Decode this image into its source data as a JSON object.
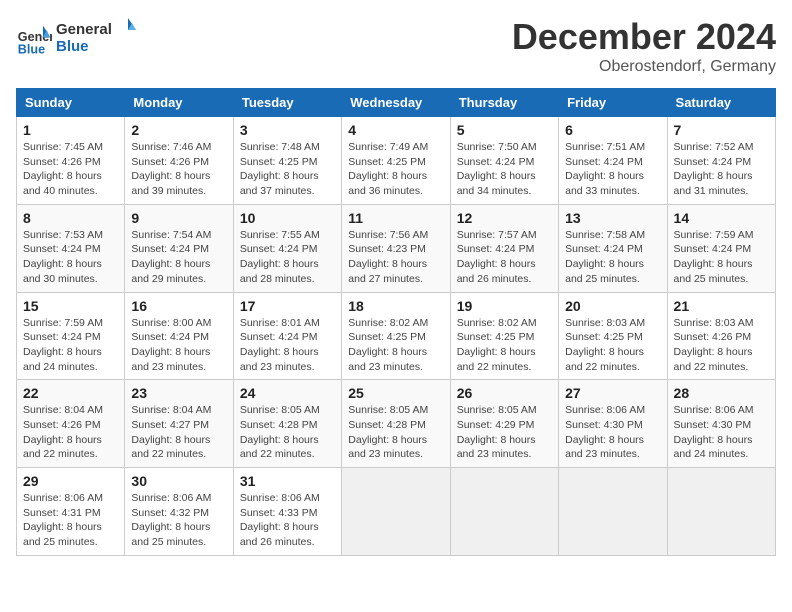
{
  "logo": {
    "line1": "General",
    "line2": "Blue"
  },
  "title": "December 2024",
  "location": "Oberostendorf, Germany",
  "days_of_week": [
    "Sunday",
    "Monday",
    "Tuesday",
    "Wednesday",
    "Thursday",
    "Friday",
    "Saturday"
  ],
  "weeks": [
    [
      {
        "day": "1",
        "sunrise": "7:45 AM",
        "sunset": "4:26 PM",
        "daylight": "8 hours and 40 minutes."
      },
      {
        "day": "2",
        "sunrise": "7:46 AM",
        "sunset": "4:26 PM",
        "daylight": "8 hours and 39 minutes."
      },
      {
        "day": "3",
        "sunrise": "7:48 AM",
        "sunset": "4:25 PM",
        "daylight": "8 hours and 37 minutes."
      },
      {
        "day": "4",
        "sunrise": "7:49 AM",
        "sunset": "4:25 PM",
        "daylight": "8 hours and 36 minutes."
      },
      {
        "day": "5",
        "sunrise": "7:50 AM",
        "sunset": "4:24 PM",
        "daylight": "8 hours and 34 minutes."
      },
      {
        "day": "6",
        "sunrise": "7:51 AM",
        "sunset": "4:24 PM",
        "daylight": "8 hours and 33 minutes."
      },
      {
        "day": "7",
        "sunrise": "7:52 AM",
        "sunset": "4:24 PM",
        "daylight": "8 hours and 31 minutes."
      }
    ],
    [
      {
        "day": "8",
        "sunrise": "7:53 AM",
        "sunset": "4:24 PM",
        "daylight": "8 hours and 30 minutes."
      },
      {
        "day": "9",
        "sunrise": "7:54 AM",
        "sunset": "4:24 PM",
        "daylight": "8 hours and 29 minutes."
      },
      {
        "day": "10",
        "sunrise": "7:55 AM",
        "sunset": "4:24 PM",
        "daylight": "8 hours and 28 minutes."
      },
      {
        "day": "11",
        "sunrise": "7:56 AM",
        "sunset": "4:23 PM",
        "daylight": "8 hours and 27 minutes."
      },
      {
        "day": "12",
        "sunrise": "7:57 AM",
        "sunset": "4:24 PM",
        "daylight": "8 hours and 26 minutes."
      },
      {
        "day": "13",
        "sunrise": "7:58 AM",
        "sunset": "4:24 PM",
        "daylight": "8 hours and 25 minutes."
      },
      {
        "day": "14",
        "sunrise": "7:59 AM",
        "sunset": "4:24 PM",
        "daylight": "8 hours and 25 minutes."
      }
    ],
    [
      {
        "day": "15",
        "sunrise": "7:59 AM",
        "sunset": "4:24 PM",
        "daylight": "8 hours and 24 minutes."
      },
      {
        "day": "16",
        "sunrise": "8:00 AM",
        "sunset": "4:24 PM",
        "daylight": "8 hours and 23 minutes."
      },
      {
        "day": "17",
        "sunrise": "8:01 AM",
        "sunset": "4:24 PM",
        "daylight": "8 hours and 23 minutes."
      },
      {
        "day": "18",
        "sunrise": "8:02 AM",
        "sunset": "4:25 PM",
        "daylight": "8 hours and 23 minutes."
      },
      {
        "day": "19",
        "sunrise": "8:02 AM",
        "sunset": "4:25 PM",
        "daylight": "8 hours and 22 minutes."
      },
      {
        "day": "20",
        "sunrise": "8:03 AM",
        "sunset": "4:25 PM",
        "daylight": "8 hours and 22 minutes."
      },
      {
        "day": "21",
        "sunrise": "8:03 AM",
        "sunset": "4:26 PM",
        "daylight": "8 hours and 22 minutes."
      }
    ],
    [
      {
        "day": "22",
        "sunrise": "8:04 AM",
        "sunset": "4:26 PM",
        "daylight": "8 hours and 22 minutes."
      },
      {
        "day": "23",
        "sunrise": "8:04 AM",
        "sunset": "4:27 PM",
        "daylight": "8 hours and 22 minutes."
      },
      {
        "day": "24",
        "sunrise": "8:05 AM",
        "sunset": "4:28 PM",
        "daylight": "8 hours and 22 minutes."
      },
      {
        "day": "25",
        "sunrise": "8:05 AM",
        "sunset": "4:28 PM",
        "daylight": "8 hours and 23 minutes."
      },
      {
        "day": "26",
        "sunrise": "8:05 AM",
        "sunset": "4:29 PM",
        "daylight": "8 hours and 23 minutes."
      },
      {
        "day": "27",
        "sunrise": "8:06 AM",
        "sunset": "4:30 PM",
        "daylight": "8 hours and 23 minutes."
      },
      {
        "day": "28",
        "sunrise": "8:06 AM",
        "sunset": "4:30 PM",
        "daylight": "8 hours and 24 minutes."
      }
    ],
    [
      {
        "day": "29",
        "sunrise": "8:06 AM",
        "sunset": "4:31 PM",
        "daylight": "8 hours and 25 minutes."
      },
      {
        "day": "30",
        "sunrise": "8:06 AM",
        "sunset": "4:32 PM",
        "daylight": "8 hours and 25 minutes."
      },
      {
        "day": "31",
        "sunrise": "8:06 AM",
        "sunset": "4:33 PM",
        "daylight": "8 hours and 26 minutes."
      },
      null,
      null,
      null,
      null
    ]
  ],
  "labels": {
    "sunrise": "Sunrise:",
    "sunset": "Sunset:",
    "daylight": "Daylight:"
  }
}
